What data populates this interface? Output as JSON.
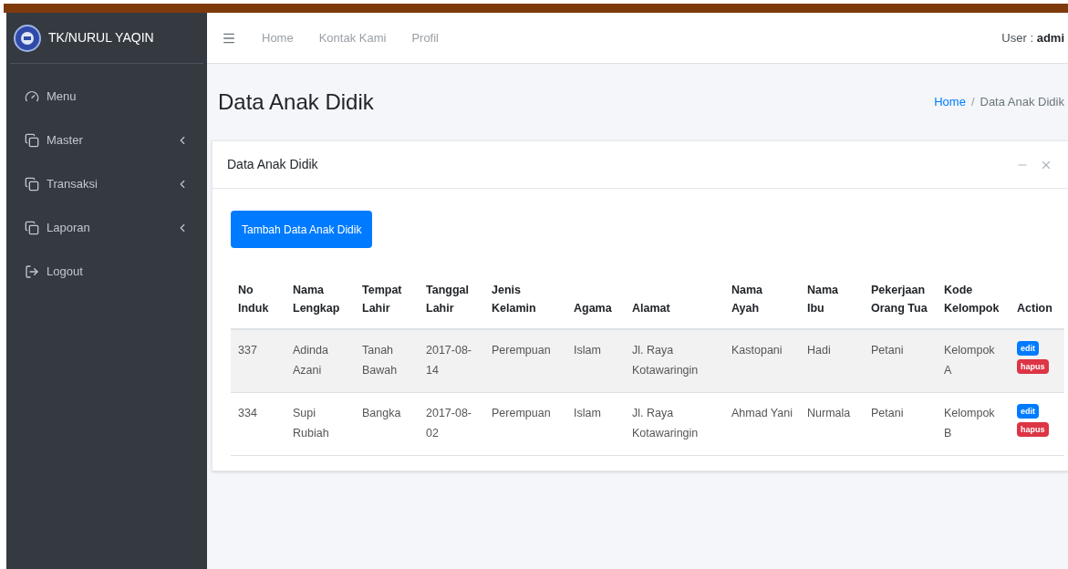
{
  "brand": {
    "name": "TK/NURUL YAQIN"
  },
  "sidebar": {
    "items": [
      {
        "label": "Menu",
        "kind": "dashboard",
        "has_submenu": false
      },
      {
        "label": "Master",
        "kind": "pages",
        "has_submenu": true
      },
      {
        "label": "Transaksi",
        "kind": "pages",
        "has_submenu": true
      },
      {
        "label": "Laporan",
        "kind": "pages",
        "has_submenu": true
      },
      {
        "label": "Logout",
        "kind": "logout",
        "has_submenu": false
      }
    ]
  },
  "navbar": {
    "links": [
      "Home",
      "Kontak Kami",
      "Profil"
    ],
    "user_label": "User :",
    "user_name": "admi"
  },
  "page": {
    "title": "Data Anak Didik",
    "breadcrumb": [
      "Home",
      "Data Anak Didik"
    ],
    "breadcrumb_separator": "/"
  },
  "card": {
    "title": "Data Anak Didik",
    "add_button": "Tambah Data Anak Didik",
    "table": {
      "columns": [
        "No Induk",
        "Nama Lengkap",
        "Tempat Lahir",
        "Tanggal Lahir",
        "Jenis Kelamin",
        "Agama",
        "Alamat",
        "Nama Ayah",
        "Nama Ibu",
        "Pekerjaan Orang Tua",
        "Kode Kelompok",
        "Action"
      ],
      "rows": [
        {
          "cells": [
            "337",
            "Adinda Azani",
            "Tanah Bawah",
            "2017-08-14",
            "Perempuan",
            "Islam",
            "Jl. Raya Kotawaringin",
            "Kastopani",
            "Hadi",
            "Petani",
            "Kelompok A"
          ],
          "actions": [
            "edit",
            "hapus"
          ]
        },
        {
          "cells": [
            "334",
            "Supi Rubiah",
            "Bangka",
            "2017-08-02",
            "Perempuan",
            "Islam",
            "Jl. Raya Kotawaringin",
            "Ahmad Yani",
            "Nurmala",
            "Petani",
            "Kelompok B"
          ],
          "actions": [
            "edit",
            "hapus"
          ]
        }
      ]
    }
  }
}
